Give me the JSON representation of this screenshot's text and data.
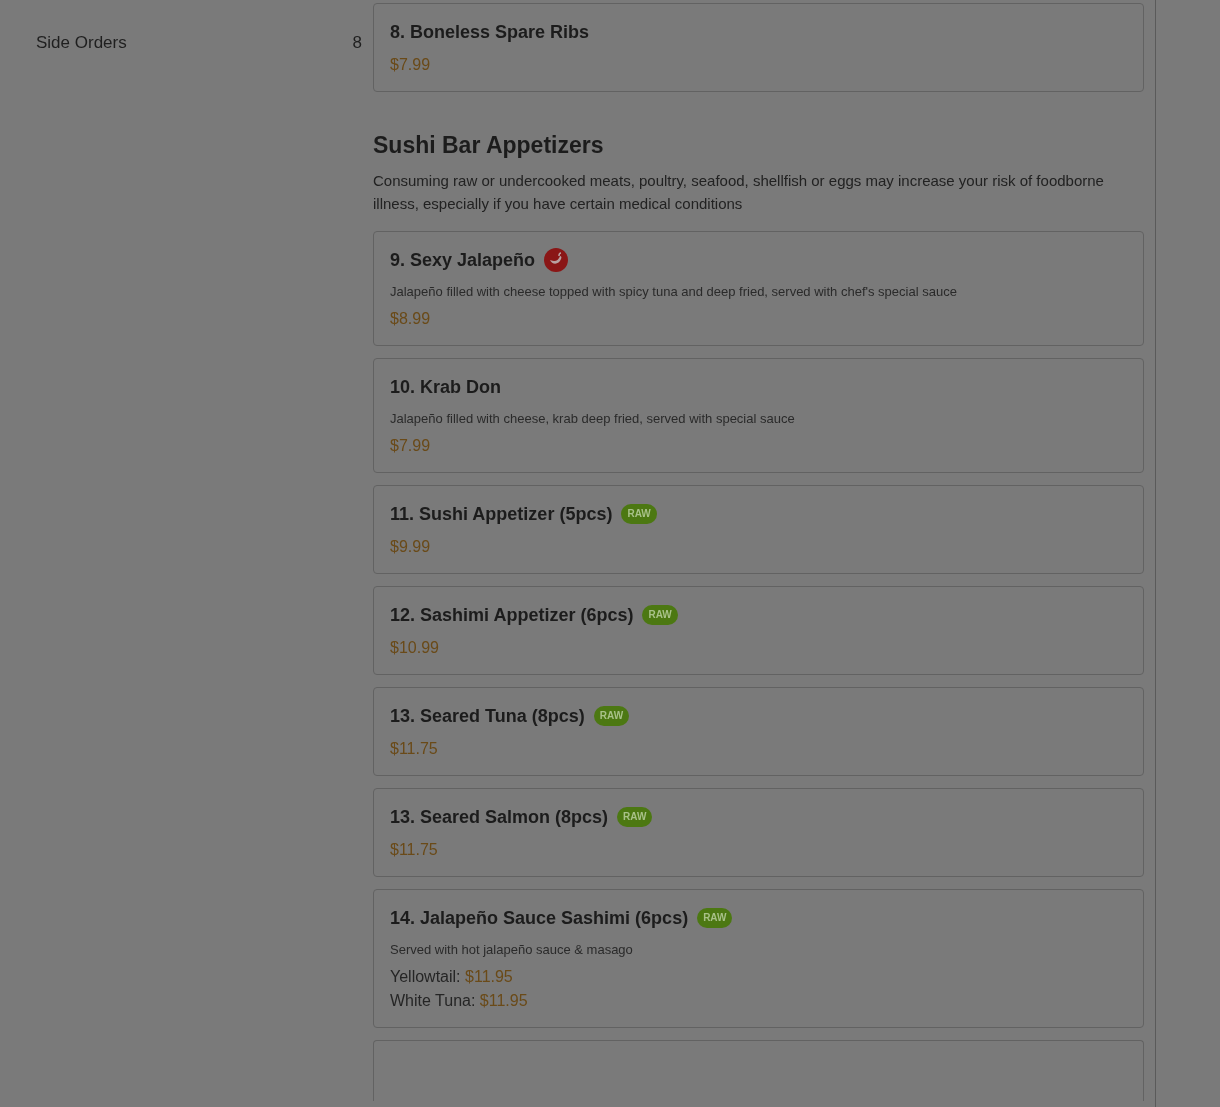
{
  "sidebar": {
    "items": [
      {
        "label": "Side Orders",
        "count": "8"
      }
    ]
  },
  "sections": [
    {
      "items": [
        {
          "title": "8. Boneless Spare Ribs",
          "price": "$7.99"
        }
      ]
    },
    {
      "title": "Sushi Bar Appetizers",
      "note": "Consuming raw or undercooked meats, poultry, seafood, shellfish or eggs may increase your risk of foodborne illness, especially if you have certain medical conditions",
      "items": [
        {
          "title": "9. Sexy Jalapeño",
          "tag": {
            "kind": "spicy"
          },
          "description": "Jalapeño filled with cheese topped with spicy tuna and deep fried, served with chef's special sauce",
          "price": "$8.99"
        },
        {
          "title": "10. Krab Don",
          "description": "Jalapeño filled with cheese, krab deep fried, served with special sauce",
          "price": "$7.99"
        },
        {
          "title": "11. Sushi Appetizer (5pcs)",
          "tag": {
            "kind": "badge",
            "label": "RAW"
          },
          "price": "$9.99"
        },
        {
          "title": "12. Sashimi Appetizer (6pcs)",
          "tag": {
            "kind": "badge",
            "label": "RAW"
          },
          "price": "$10.99"
        },
        {
          "title": "13. Seared Tuna (8pcs)",
          "tag": {
            "kind": "badge",
            "label": "RAW"
          },
          "price": "$11.75"
        },
        {
          "title": "13. Seared Salmon (8pcs)",
          "tag": {
            "kind": "badge",
            "label": "RAW"
          },
          "price": "$11.75"
        },
        {
          "title": "14. Jalapeño Sauce Sashimi (6pcs)",
          "tag": {
            "kind": "badge",
            "label": "RAW"
          },
          "description": "Served with hot jalapeño sauce & masago",
          "options": [
            {
              "label": "Yellowtail:",
              "price": "$11.95"
            },
            {
              "label": "White Tuna:",
              "price": "$11.95"
            }
          ]
        }
      ]
    }
  ]
}
